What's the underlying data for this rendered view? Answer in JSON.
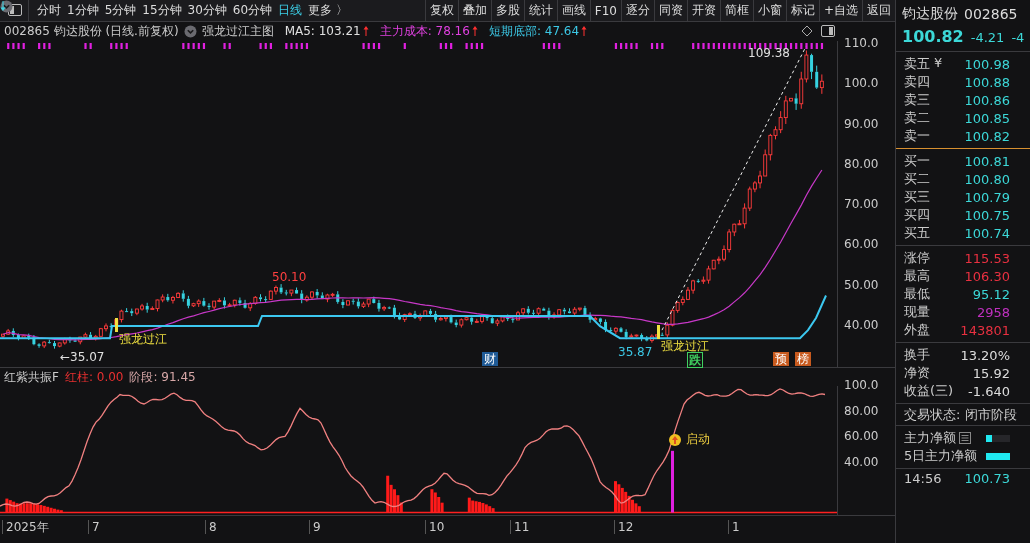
{
  "toolbar": {
    "periods": [
      {
        "label": "分时",
        "selected": false
      },
      {
        "label": "1分钟",
        "selected": false
      },
      {
        "label": "5分钟",
        "selected": false
      },
      {
        "label": "15分钟",
        "selected": false
      },
      {
        "label": "30分钟",
        "selected": false
      },
      {
        "label": "60分钟",
        "selected": false
      },
      {
        "label": "日线",
        "selected": true
      },
      {
        "label": "更多 〉",
        "selected": false
      }
    ],
    "buttons": [
      "复权",
      "叠加",
      "多股",
      "统计",
      "画线",
      "F10",
      "逐分",
      "同资",
      "开资",
      "简框",
      "小窗",
      "标记",
      "+自选",
      "返回"
    ]
  },
  "chart_header": {
    "title": "002865 钧达股份 (日线.前复权)",
    "indicator": "强龙过江主图",
    "values": [
      {
        "text": "MA5: 103.21",
        "color": "#e0e0e0"
      },
      {
        "text": "主力成本: 78.16",
        "color": "#e040e0"
      },
      {
        "text": "短期底部: 47.64",
        "color": "#3cc8e6"
      }
    ]
  },
  "price_axis": [
    "110.0",
    "100.0",
    "90.00",
    "80.00",
    "70.00",
    "60.00",
    "50.00",
    "40.00"
  ],
  "annotations": [
    {
      "text": "109.38",
      "kind": "price",
      "color": "#e0e0e0"
    },
    {
      "text": "50.10",
      "kind": "price",
      "color": "#ff4040"
    },
    {
      "text": "←35.07",
      "kind": "price",
      "color": "#e0e0e0"
    },
    {
      "text": "35.87",
      "kind": "price",
      "color": "#3cc8e6"
    },
    {
      "text": "强龙过江",
      "kind": "signal",
      "color": "#f0e040"
    },
    {
      "text": "强龙过江",
      "kind": "signal",
      "color": "#f0e040"
    },
    {
      "text": "财",
      "kind": "tag",
      "color": "#1f5a96"
    },
    {
      "text": "跌",
      "kind": "mark",
      "color": "#40d060"
    },
    {
      "text": "预",
      "kind": "tag",
      "color": "#c85a1e"
    },
    {
      "text": "榜",
      "kind": "tag",
      "color": "#c85a1e"
    }
  ],
  "indicator": {
    "name": "红紫共振F",
    "values": [
      {
        "text": "红柱: 0.00",
        "color": "#e83030"
      },
      {
        "text": "阶段: 91.45",
        "color": "#d8a8a8"
      }
    ],
    "axis": [
      "100.0",
      "80.00",
      "60.00",
      "40.00"
    ],
    "signal": "启动"
  },
  "time_axis": [
    "2025年",
    "7",
    "8",
    "9",
    "10",
    "11",
    "12",
    "1"
  ],
  "quote": {
    "name": "钧达股份",
    "code": "002865",
    "price": "100.82",
    "change": "-4.21",
    "change_pct": "-4",
    "sell": [
      {
        "label": "卖五",
        "price": "100.98",
        "currency": "¥"
      },
      {
        "label": "卖四",
        "price": "100.88"
      },
      {
        "label": "卖三",
        "price": "100.86"
      },
      {
        "label": "卖二",
        "price": "100.85"
      },
      {
        "label": "卖一",
        "price": "100.82"
      }
    ],
    "buy": [
      {
        "label": "买一",
        "price": "100.81"
      },
      {
        "label": "买二",
        "price": "100.80"
      },
      {
        "label": "买三",
        "price": "100.79"
      },
      {
        "label": "买四",
        "price": "100.75"
      },
      {
        "label": "买五",
        "price": "100.74"
      }
    ],
    "stats": [
      {
        "label": "涨停",
        "value": "115.53",
        "color": "#e83040"
      },
      {
        "label": "最高",
        "value": "106.30",
        "color": "#e83040"
      },
      {
        "label": "最低",
        "value": "95.12",
        "color": "#3cd8d8"
      },
      {
        "label": "现量",
        "value": "2958",
        "color": "#c030c0"
      },
      {
        "label": "外盘",
        "value": "143801",
        "color": "#e83040"
      }
    ],
    "extra": [
      {
        "label": "换手",
        "value": "13.20%"
      },
      {
        "label": "净资",
        "value": "15.92"
      },
      {
        "label": "收益(三)",
        "value": "-1.640"
      }
    ],
    "trade_status": "交易状态: 闭市阶段",
    "flows": [
      {
        "label": "主力净额",
        "kind": "menu",
        "level": 0.25
      },
      {
        "label": "5日主力净额",
        "kind": "plain",
        "level": 1
      }
    ],
    "tick": {
      "time": "14:56",
      "price": "100.73"
    }
  }
}
